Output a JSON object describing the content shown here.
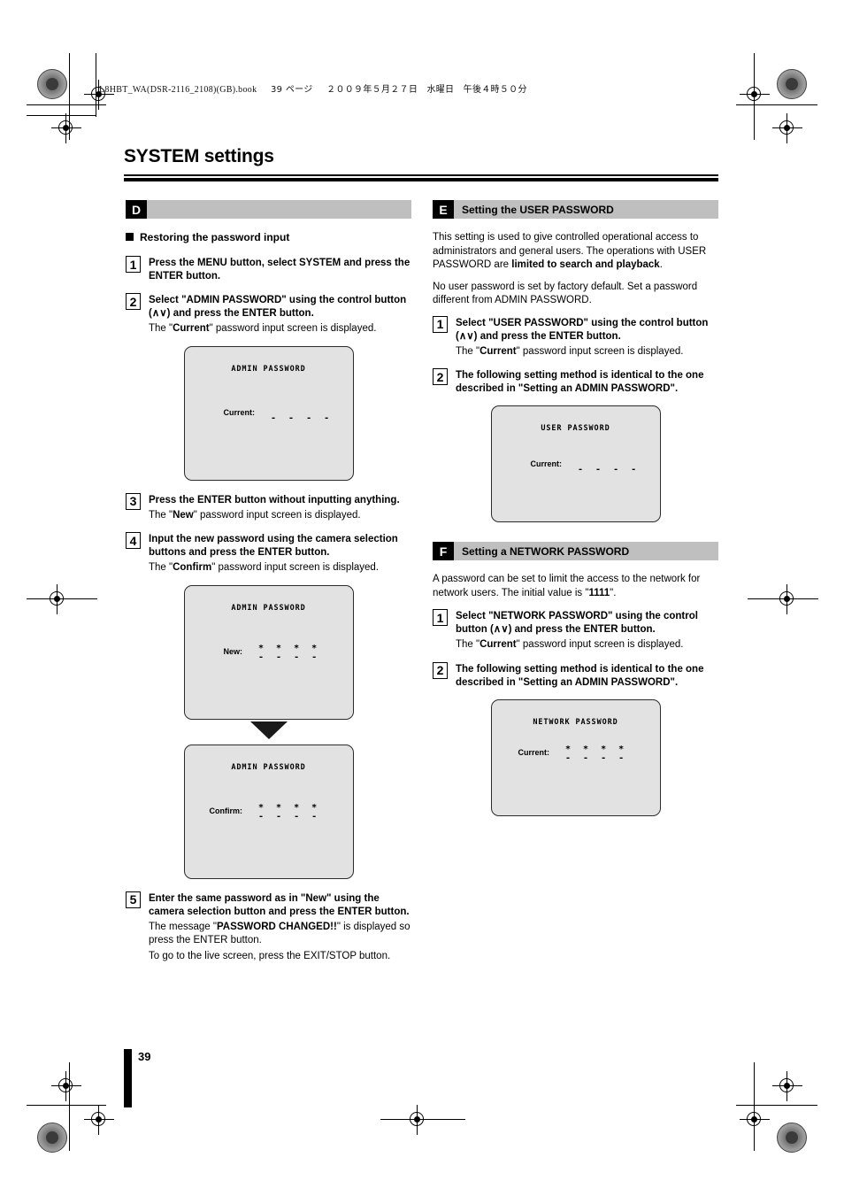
{
  "print_header": {
    "filename": "L8HBT_WA(DSR-2116_2108)(GB).book",
    "page_label": "39 ページ",
    "date": "２００９年５月２７日　水曜日　午後４時５０分"
  },
  "page_title": "SYSTEM settings",
  "page_number": "39",
  "left_column": {
    "section": {
      "letter": "D",
      "title": ""
    },
    "subheading": "Restoring the password input",
    "steps": [
      {
        "num": "1",
        "title": "Press the MENU button, select SYSTEM and press the ENTER button.",
        "note": ""
      },
      {
        "num": "2",
        "title": "Select \"ADMIN PASSWORD\" using the control button (∧∨) and press the ENTER button.",
        "note_pre": "The \"",
        "note_bold": "Current",
        "note_post": "\" password input screen is displayed."
      },
      {
        "num": "3",
        "title": "Press the ENTER button without inputting anything.",
        "note_pre": "The \"",
        "note_bold": "New",
        "note_post": "\" password input screen is displayed."
      },
      {
        "num": "4",
        "title": "Input the new password using the camera selection buttons and press the ENTER button.",
        "note_pre": "The \"",
        "note_bold": "Confirm",
        "note_post": "\" password input screen is displayed."
      },
      {
        "num": "5",
        "title": "Enter the same password as in \"New\" using the camera selection button and press the ENTER button.",
        "note_pre": "The message \"",
        "note_bold": "PASSWORD CHANGED!!",
        "note_post": "\" is displayed so press the ENTER button.",
        "note2": "To go to the live screen, press the EXIT/STOP button."
      }
    ],
    "screens": [
      {
        "title": "ADMIN  PASSWORD",
        "field_label": "Current:",
        "stars": "",
        "dashes": "- - - -"
      },
      {
        "title": "ADMIN  PASSWORD",
        "field_label": "New:",
        "stars": "* * * *",
        "dashes": "- - - -"
      },
      {
        "title": "ADMIN  PASSWORD",
        "field_label": "Confirm:",
        "stars": "* * * *",
        "dashes": "- - - -"
      }
    ]
  },
  "right_column": {
    "section_e": {
      "letter": "E",
      "title": "Setting the USER PASSWORD",
      "para1_pre": "This setting is used to give controlled operational access to administrators and general users. The operations with USER PASSWORD are ",
      "para1_bold": "limited to search and playback",
      "para1_post": ".",
      "para2": "No user password is set by factory default. Set a password different from ADMIN PASSWORD.",
      "steps": [
        {
          "num": "1",
          "title": "Select \"USER PASSWORD\" using the control button (∧∨) and press the ENTER button.",
          "note_pre": "The \"",
          "note_bold": "Current",
          "note_post": "\" password input screen is displayed."
        },
        {
          "num": "2",
          "title": "The following setting method is identical to the one described in \"Setting an ADMIN PASSWORD\".",
          "note": ""
        }
      ],
      "screen": {
        "title": "USER  PASSWORD",
        "field_label": "Current:",
        "stars": "",
        "dashes": "- - - -"
      }
    },
    "section_f": {
      "letter": "F",
      "title": "Setting a NETWORK PASSWORD",
      "para1_pre": "A password can be set to limit the access to the network for network users. The initial value is \"",
      "para1_bold": "1111",
      "para1_post": "\".",
      "steps": [
        {
          "num": "1",
          "title": "Select \"NETWORK PASSWORD\" using the control button (∧∨) and press the ENTER button.",
          "note_pre": "The \"",
          "note_bold": "Current",
          "note_post": "\" password input screen is displayed."
        },
        {
          "num": "2",
          "title": "The following setting method is identical to the one described in \"Setting an ADMIN PASSWORD\".",
          "note": ""
        }
      ],
      "screen": {
        "title": "NETWORK  PASSWORD",
        "field_label": "Current:",
        "stars": "* * * *",
        "dashes": "- - - -"
      }
    }
  }
}
